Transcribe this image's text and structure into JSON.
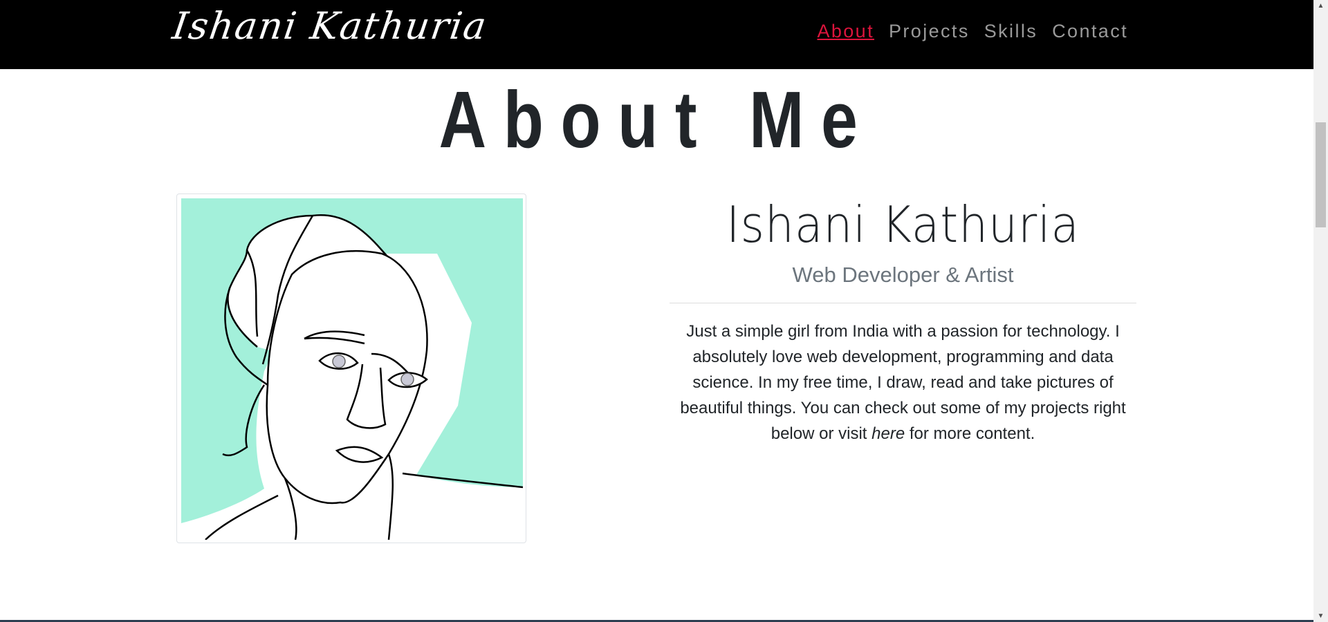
{
  "navbar": {
    "brand": "Ishani Kathuria",
    "links": [
      {
        "label": "About",
        "active": true
      },
      {
        "label": "Projects",
        "active": false
      },
      {
        "label": "Skills",
        "active": false
      },
      {
        "label": "Contact",
        "active": false
      }
    ],
    "active_color": "#dc143c"
  },
  "about": {
    "title": "About Me",
    "name": "Ishani Kathuria",
    "role": "Web Developer & Artist",
    "bio_before": "Just a simple girl from India with a passion for technology. I absolutely love web development, programming and data science. In my free time, I draw, read and take pictures of beautiful things. You can check out some of my projects right below or visit ",
    "bio_link": "here",
    "bio_after": " for more content."
  },
  "portrait": {
    "icon": "portrait-illustration",
    "background_color": "#a3f0da"
  }
}
